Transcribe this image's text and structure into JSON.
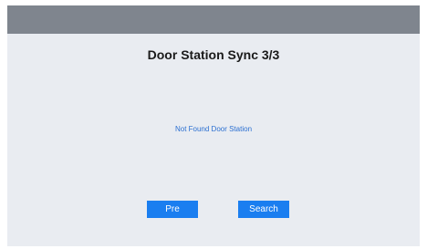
{
  "title": "Door Station Sync 3/3",
  "status": "Not Found Door Station",
  "buttons": {
    "pre_label": "Pre",
    "search_label": "Search"
  },
  "colors": {
    "top_bar": "#7f858e",
    "background": "#e9ecf1",
    "accent": "#1a7ef0",
    "status_text": "#2b6fd1"
  }
}
